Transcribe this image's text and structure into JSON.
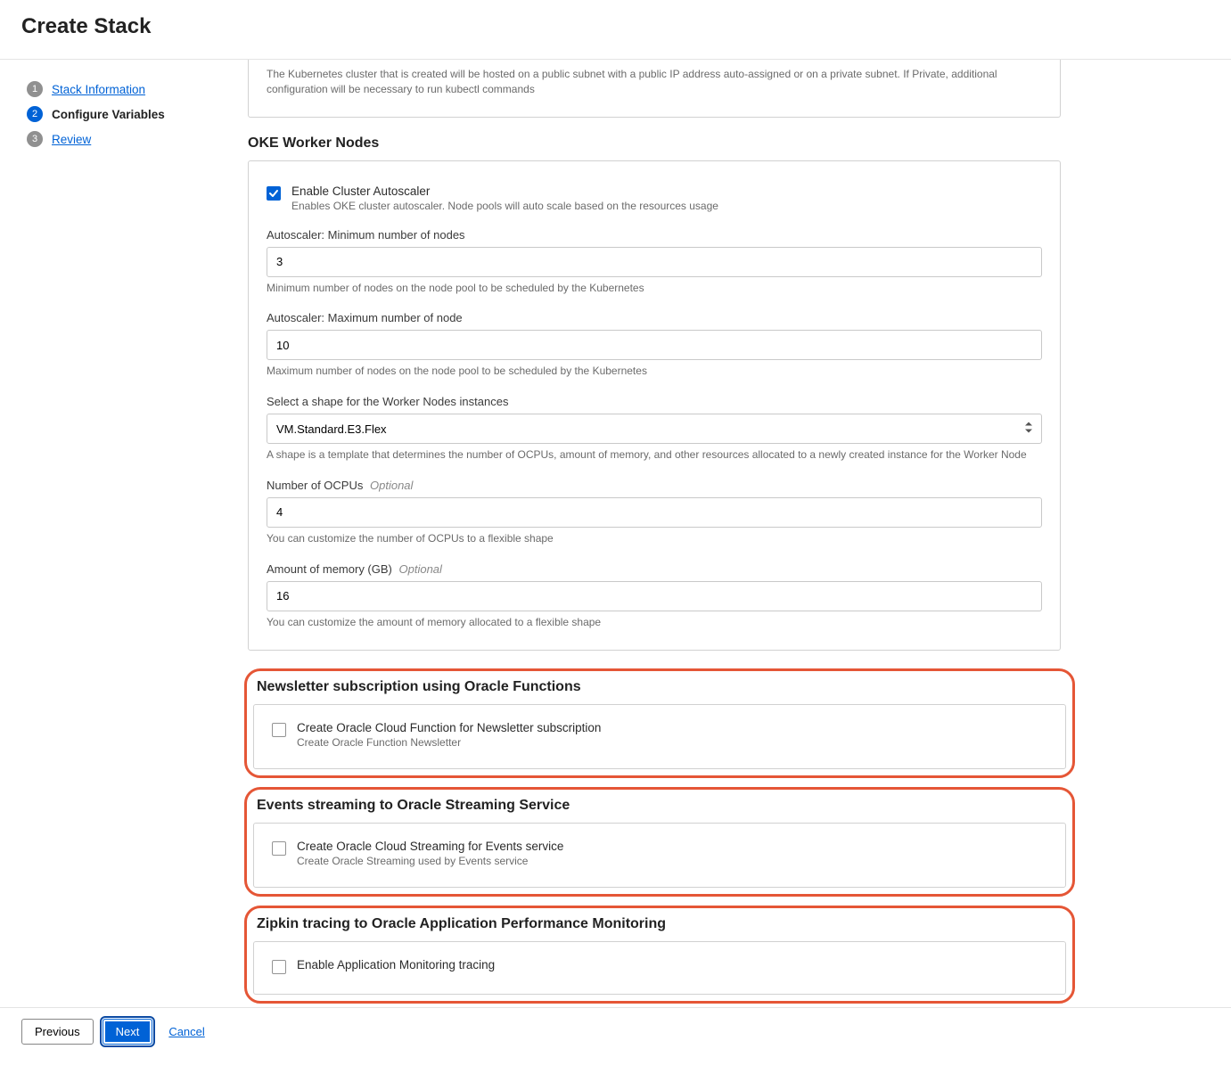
{
  "header": {
    "title": "Create Stack"
  },
  "steps": [
    {
      "num": "1",
      "label": "Stack Information"
    },
    {
      "num": "2",
      "label": "Configure Variables"
    },
    {
      "num": "3",
      "label": "Review"
    }
  ],
  "top_help": "The Kubernetes cluster that is created will be hosted on a public subnet with a public IP address auto-assigned or on a private subnet. If Private, additional configuration will be necessary to run kubectl commands",
  "oke": {
    "title": "OKE Worker Nodes",
    "autoscaler": {
      "checked": true,
      "label": "Enable Cluster Autoscaler",
      "help": "Enables OKE cluster autoscaler. Node pools will auto scale based on the resources usage"
    },
    "min_nodes": {
      "label": "Autoscaler: Minimum number of nodes",
      "value": "3",
      "help": "Minimum number of nodes on the node pool to be scheduled by the Kubernetes"
    },
    "max_nodes": {
      "label": "Autoscaler: Maximum number of node",
      "value": "10",
      "help": "Maximum number of nodes on the node pool to be scheduled by the Kubernetes"
    },
    "shape": {
      "label": "Select a shape for the Worker Nodes instances",
      "value": "VM.Standard.E3.Flex",
      "help": "A shape is a template that determines the number of OCPUs, amount of memory, and other resources allocated to a newly created instance for the Worker Node"
    },
    "ocpus": {
      "label": "Number of OCPUs",
      "optional": "Optional",
      "value": "4",
      "help": "You can customize the number of OCPUs to a flexible shape"
    },
    "memory": {
      "label": "Amount of memory (GB)",
      "optional": "Optional",
      "value": "16",
      "help": "You can customize the amount of memory allocated to a flexible shape"
    }
  },
  "newsletter": {
    "title": "Newsletter subscription using Oracle Functions",
    "chk_label": "Create Oracle Cloud Function for Newsletter subscription",
    "chk_help": "Create Oracle Function Newsletter"
  },
  "streaming": {
    "title": "Events streaming to Oracle Streaming Service",
    "chk_label": "Create Oracle Cloud Streaming for Events service",
    "chk_help": "Create Oracle Streaming used by Events service"
  },
  "zipkin": {
    "title": "Zipkin tracing to Oracle Application Performance Monitoring",
    "chk_label": "Enable Application Monitoring tracing"
  },
  "footer": {
    "previous": "Previous",
    "next": "Next",
    "cancel": "Cancel"
  }
}
